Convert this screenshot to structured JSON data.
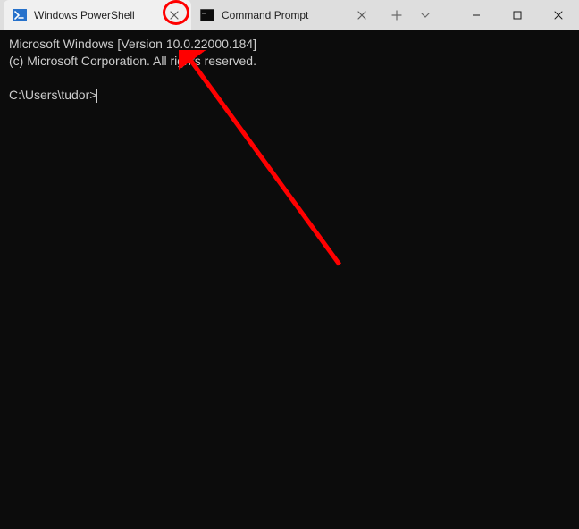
{
  "tabs": [
    {
      "label": "Windows PowerShell",
      "icon": "powershell"
    },
    {
      "label": "Command Prompt",
      "icon": "cmd"
    }
  ],
  "terminal": {
    "line1": "Microsoft Windows [Version 10.0.22000.184]",
    "line2": "(c) Microsoft Corporation. All rights reserved.",
    "blank": "",
    "prompt": "C:\\Users\\tudor>"
  }
}
